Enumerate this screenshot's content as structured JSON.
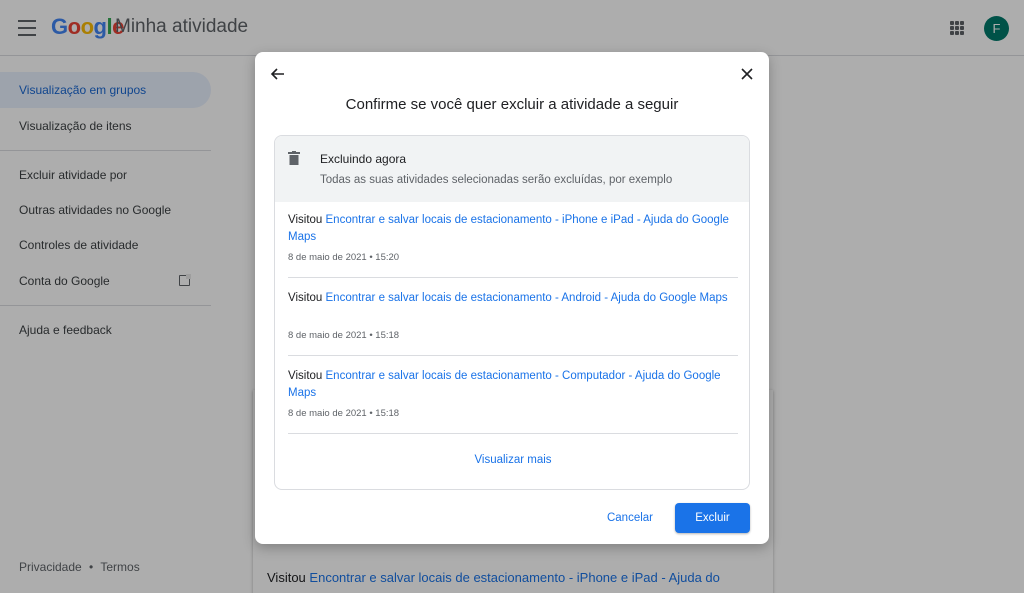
{
  "app": {
    "logo_letters": [
      "G",
      "o",
      "o",
      "g",
      "l",
      "e"
    ],
    "logo_colors": [
      "#4285f4",
      "#ea4335",
      "#fbbc05",
      "#4285f4",
      "#34a853",
      "#ea4335"
    ],
    "title": "Minha atividade",
    "avatar_letter": "F",
    "avatar_color": "#00796b"
  },
  "sidebar": {
    "items": [
      {
        "label": "Visualização em grupos",
        "active": true
      },
      {
        "label": "Visualização de itens",
        "active": false
      },
      {
        "label": "Excluir atividade por",
        "active": false
      },
      {
        "label": "Outras atividades no Google",
        "active": false
      },
      {
        "label": "Controles de atividade",
        "active": false
      },
      {
        "label": "Conta do Google",
        "active": false
      },
      {
        "label": "Ajuda e feedback",
        "active": false
      }
    ],
    "footer": {
      "privacy": "Privacidade",
      "separator": "•",
      "terms": "Termos"
    }
  },
  "background": {
    "visit_verb": "Visitou",
    "visit_link": "Encontrar e salvar locais de estacionamento - iPhone e iPad - Ajuda do"
  },
  "dialog": {
    "title": "Confirme se você quer excluir a atividade a seguir",
    "deleting_title": "Excluindo agora",
    "deleting_subtitle": "Todas as suas atividades selecionadas serão excluídas, por exemplo",
    "entries": [
      {
        "verb": "Visitou",
        "link": "Encontrar e salvar locais de estacionamento - iPhone e iPad - Ajuda do Google Maps",
        "date": "8 de maio de 2021 • 15:20"
      },
      {
        "verb": "Visitou",
        "link": "Encontrar e salvar locais de estacionamento - Android - Ajuda do Google Maps",
        "date": "8 de maio de 2021 • 15:18"
      },
      {
        "verb": "Visitou",
        "link": "Encontrar e salvar locais de estacionamento - Computador - Ajuda do Google Maps",
        "date": "8 de maio de 2021 • 15:18"
      }
    ],
    "view_more": "Visualizar mais",
    "cancel": "Cancelar",
    "confirm": "Excluir"
  }
}
